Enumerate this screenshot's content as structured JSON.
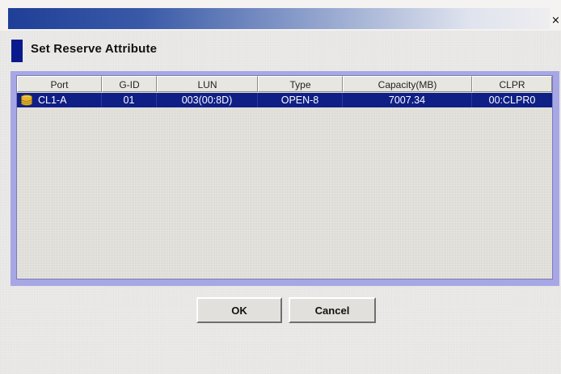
{
  "window": {
    "close_glyph": "×"
  },
  "dialog": {
    "title": "Set Reserve Attribute"
  },
  "table": {
    "columns": [
      "Port",
      "G-ID",
      "LUN",
      "Type",
      "Capacity(MB)",
      "CLPR"
    ],
    "rows": [
      {
        "icon": "storage-disk-icon",
        "port": "CL1-A",
        "gid": "01",
        "lun": "003(00:8D)",
        "type": "OPEN-8",
        "capacity": "7007.34",
        "clpr": "00:CLPR0",
        "selected": true
      }
    ]
  },
  "buttons": {
    "ok_label": "OK",
    "cancel_label": "Cancel"
  },
  "colors": {
    "title_gradient_start": "#1f3f97",
    "selection": "#0f1f86",
    "heading_marker": "#0a1a8c",
    "table_frame": "#a7a7e6"
  }
}
